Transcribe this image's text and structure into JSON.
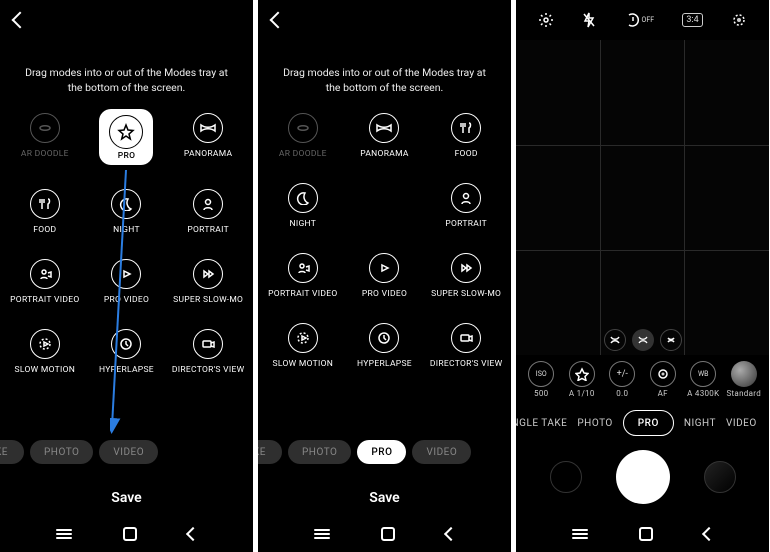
{
  "instruction_text": "Drag modes into or out of the Modes tray at the bottom of the screen.",
  "save_label": "Save",
  "panel1": {
    "modes": [
      {
        "label": "AR DOODLE",
        "icon": "ar-doodle",
        "dim": true
      },
      {
        "label": "PRO",
        "icon": "pro",
        "highlight": true
      },
      {
        "label": "PANORAMA",
        "icon": "panorama"
      },
      {
        "label": "FOOD",
        "icon": "food"
      },
      {
        "label": "NIGHT",
        "icon": "night"
      },
      {
        "label": "PORTRAIT",
        "icon": "portrait"
      },
      {
        "label": "PORTRAIT VIDEO",
        "icon": "portrait-video"
      },
      {
        "label": "PRO VIDEO",
        "icon": "pro-video"
      },
      {
        "label": "SUPER SLOW-MO",
        "icon": "super-slow-mo"
      },
      {
        "label": "SLOW MOTION",
        "icon": "slow-motion"
      },
      {
        "label": "HYPERLAPSE",
        "icon": "hyperlapse"
      },
      {
        "label": "DIRECTOR'S VIEW",
        "icon": "directors-view"
      }
    ],
    "tray": [
      "AKE",
      "PHOTO",
      "VIDEO"
    ]
  },
  "panel2": {
    "modes": [
      {
        "label": "AR DOODLE",
        "icon": "ar-doodle",
        "dim": true
      },
      {
        "label": "PANORAMA",
        "icon": "panorama"
      },
      {
        "label": "FOOD",
        "icon": "food"
      },
      {
        "label": "NIGHT",
        "icon": "night"
      },
      {
        "label": "",
        "icon": "blank",
        "blank": true
      },
      {
        "label": "PORTRAIT",
        "icon": "portrait"
      },
      {
        "label": "PORTRAIT VIDEO",
        "icon": "portrait-video"
      },
      {
        "label": "PRO VIDEO",
        "icon": "pro-video"
      },
      {
        "label": "SUPER SLOW-MO",
        "icon": "super-slow-mo"
      },
      {
        "label": "SLOW MOTION",
        "icon": "slow-motion"
      },
      {
        "label": "HYPERLAPSE",
        "icon": "hyperlapse"
      },
      {
        "label": "DIRECTOR'S VIEW",
        "icon": "directors-view"
      }
    ],
    "tray": [
      "AKE",
      "PHOTO",
      "PRO",
      "VIDEO"
    ],
    "tray_active_index": 2
  },
  "panel3": {
    "top_icons": [
      "settings",
      "flash-off",
      "timer-off",
      "ratio-3-4",
      "motion-photo"
    ],
    "timer_off_label": "OFF",
    "ratio_label": "3:4",
    "settings": [
      {
        "top": "ISO",
        "value": "500"
      },
      {
        "top": "shutter",
        "value": "A 1/10"
      },
      {
        "top": "ev",
        "value": "0.0"
      },
      {
        "top": "focus",
        "value": "AF"
      },
      {
        "top": "WB",
        "value": "A 4300K"
      },
      {
        "top": "profile",
        "value": "Standard"
      }
    ],
    "modes": [
      "INGLE TAKE",
      "PHOTO",
      "PRO",
      "NIGHT",
      "VIDEO"
    ],
    "modes_active_index": 2
  }
}
